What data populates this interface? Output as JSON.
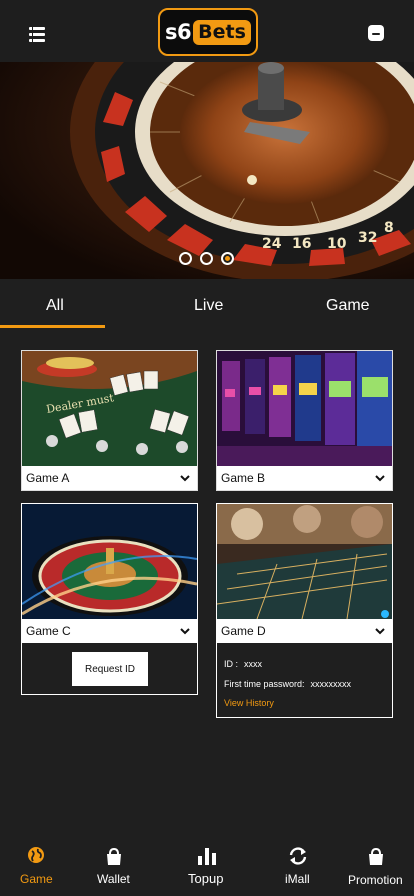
{
  "header": {
    "logo_left": "s6",
    "logo_right": "Bets",
    "menu_icon": "menu-icon",
    "user_icon": "user-icon"
  },
  "banner": {
    "slides": 3,
    "active_slide": 3
  },
  "tabs": [
    {
      "label": "All",
      "active": true
    },
    {
      "label": "Live",
      "active": false
    },
    {
      "label": "Game",
      "active": false
    }
  ],
  "games": [
    {
      "name": "Game A"
    },
    {
      "name": "Game B"
    },
    {
      "name": "Game C",
      "button": "Request ID"
    },
    {
      "name": "Game D",
      "id_label": "ID :",
      "id_value": "xxxx",
      "pw_label": "First time password:",
      "pw_value": "xxxxxxxxx",
      "history": "View History"
    }
  ],
  "bottom_nav": [
    {
      "label": "Game",
      "icon": "globe-icon",
      "active": true
    },
    {
      "label": "Wallet",
      "icon": "bag-icon"
    },
    {
      "label": "Topup",
      "icon": "bar-chart-icon"
    },
    {
      "label": "iMall",
      "icon": "refresh-icon"
    },
    {
      "label": "Promotion",
      "icon": "bag-icon"
    }
  ],
  "colors": {
    "accent": "#f29a12",
    "background": "#1f1f1f",
    "text": "#ffffff"
  }
}
